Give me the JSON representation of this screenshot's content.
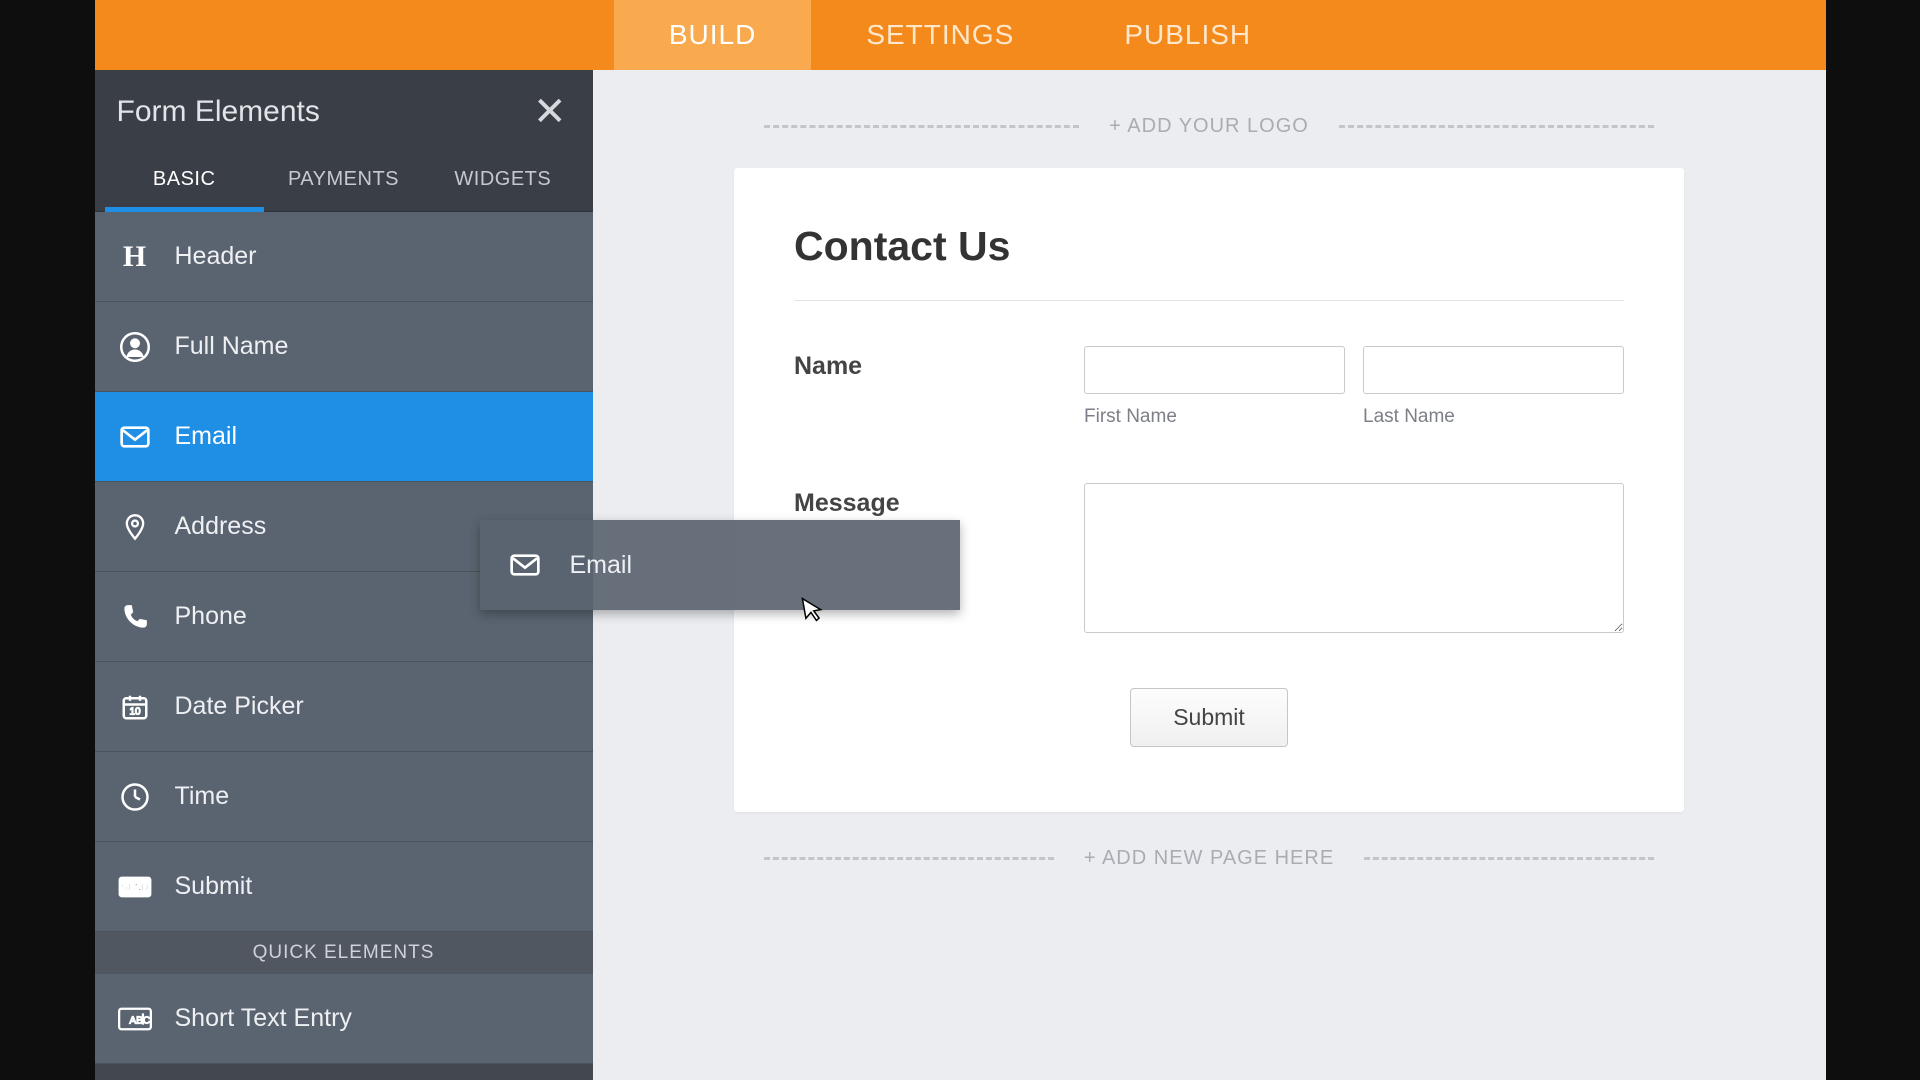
{
  "topnav": {
    "items": [
      {
        "label": "BUILD",
        "active": true
      },
      {
        "label": "SETTINGS",
        "active": false
      },
      {
        "label": "PUBLISH",
        "active": false
      }
    ]
  },
  "sidebar": {
    "title": "Form Elements",
    "tabs": [
      {
        "label": "BASIC",
        "active": true
      },
      {
        "label": "PAYMENTS",
        "active": false
      },
      {
        "label": "WIDGETS",
        "active": false
      }
    ],
    "elements": [
      {
        "label": "Header",
        "icon": "header-icon",
        "selected": false
      },
      {
        "label": "Full Name",
        "icon": "user-icon",
        "selected": false
      },
      {
        "label": "Email",
        "icon": "email-icon",
        "selected": true
      },
      {
        "label": "Address",
        "icon": "location-icon",
        "selected": false
      },
      {
        "label": "Phone",
        "icon": "phone-icon",
        "selected": false
      },
      {
        "label": "Date Picker",
        "icon": "calendar-icon",
        "selected": false
      },
      {
        "label": "Time",
        "icon": "clock-icon",
        "selected": false
      },
      {
        "label": "Submit",
        "icon": "send-icon",
        "selected": false
      }
    ],
    "quick_header": "QUICK ELEMENTS",
    "quick_elements": [
      {
        "label": "Short Text Entry",
        "icon": "text-entry-icon"
      }
    ]
  },
  "canvas": {
    "add_logo": "+ ADD YOUR LOGO",
    "add_page": "+ ADD NEW PAGE HERE",
    "form": {
      "title": "Contact Us",
      "name_label": "Name",
      "first_name": "First Name",
      "last_name": "Last Name",
      "message_label": "Message",
      "submit": "Submit"
    }
  },
  "drag": {
    "label": "Email"
  }
}
